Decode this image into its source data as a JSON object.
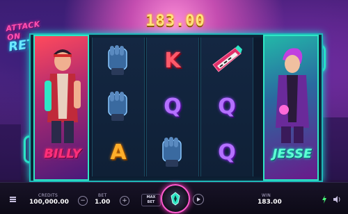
{
  "logo": {
    "line1": "ATTACK ON",
    "line2": "RETRO"
  },
  "win_banner": "183.00",
  "characters": {
    "left": "BILLY",
    "right": "JESSE"
  },
  "reels": [
    [],
    [
      "glove-icon",
      "glove-icon",
      "A"
    ],
    [
      "K",
      "Q",
      "glove-icon"
    ],
    [
      "keytar-icon",
      "Q",
      "Q"
    ],
    []
  ],
  "controls": {
    "credits_label": "CREDITS",
    "credits_value": "100,000.00",
    "bet_label": "BET",
    "bet_value": "1.00",
    "max_bet_line1": "MAX",
    "max_bet_line2": "BET",
    "win_label": "WIN",
    "win_value": "183.00",
    "minus": "−",
    "plus": "+"
  },
  "colors": {
    "accent": "#2ee6c5",
    "pink": "#ff5ad0",
    "gold": "#ffe27a"
  }
}
